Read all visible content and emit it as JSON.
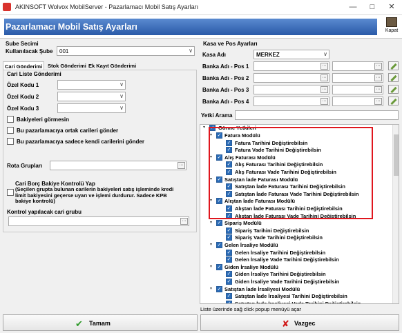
{
  "window": {
    "title": "AKINSOFT Wolvox MobilServer  - Pazarlamacı Mobil Satış Ayarları"
  },
  "header": {
    "title": "Pazarlamacı Mobil Satış Ayarları",
    "close_label": "Kapat"
  },
  "sube": {
    "section": "Sube Secimi",
    "label": "Kullanılacak Şube",
    "value": "001"
  },
  "tabs": [
    "Cari Gönderimi",
    "Stok Gönderimi",
    "Ek Kayıt Gönderimi"
  ],
  "cari": {
    "section": "Cari Liste Gönderimi",
    "ozel_kodlar": [
      "Özel Kodu 1",
      "Özel Kodu 2",
      "Özel Kodu 3"
    ],
    "options": [
      "Bakiyeleri görmesin",
      "Bu pazarlamacıya ortak carileri gönder",
      "Bu pazarlamacıya sadece kendi carilerini gönder"
    ],
    "rota_label": "Rota Grupları",
    "borc_title": "Cari Borç Bakiye Kontrolü Yap",
    "borc_desc": "(Seçilen grupta bulunan carilerin bakiyeleri satış işleminde kredi limit bakiyesini geçerse uyarı ve işlemi durdurur. Sadece KPB bakiye kontrolü)",
    "kontrol_label": "Kontrol yapılacak cari grubu"
  },
  "kasa": {
    "section": "Kasa ve Pos Ayarları",
    "kasa_label": "Kasa Adı",
    "kasa_value": "MERKEZ",
    "banks": [
      "Banka Adı - Pos 1",
      "Banka Adı - Pos 2",
      "Banka Adı - Pos 3",
      "Banka Adı - Pos 4"
    ],
    "yetki_label": "Yetki Arama"
  },
  "tree": {
    "root": "Görme Yetkileri",
    "hint": "Liste üzerinde sağ click popup menüyü açar",
    "modules": [
      {
        "name": "Fatura Modülü",
        "items": [
          "Fatura Tarihini Değiştirebilsin",
          "Fatura Vade Tarihini Değiştirebilsin"
        ]
      },
      {
        "name": "Alış Faturası Modülü",
        "items": [
          "Alış Faturası Tarihini Değiştirebilsin",
          "Alış Faturası Vade Tarihini Değiştirebilsin"
        ]
      },
      {
        "name": "Satıştan İade Faturası Modülü",
        "items": [
          "Satıştan İade Faturası Tarihini Değiştirebilsin",
          "Satıştan İade Faturası Vade Tarihini Değiştirebilsin"
        ]
      },
      {
        "name": "Alıştan İade Faturası Modülü",
        "items": [
          "Alıştan İade Faturası Tarihini Değiştirebilsin",
          "Alıştan İade Faturası Vade Tarihini Değiştirebilsin"
        ]
      },
      {
        "name": "Sipariş Modülü",
        "items": [
          "Sipariş Tarihini Değiştirebilsin",
          "Sipariş Vade Tarihini Değiştirebilsin"
        ]
      },
      {
        "name": "Gelen İrsaliye Modülü",
        "items": [
          "Gelen İrsaliye Tarihini Değiştirebilsin",
          "Gelen İrsaliye Vade Tarihini Değiştirebilsin"
        ]
      },
      {
        "name": "Giden İrsaliye Modülü",
        "items": [
          "Giden İrsaliye Tarihini Değiştirebilsin",
          "Giden İrsaliye Vade Tarihini Değiştirebilsin"
        ]
      },
      {
        "name": "Satıştan İade İrsaliyesi Modülü",
        "items": [
          "Satıştan İade İrsaliyesi Tarihini Değiştirebilsin",
          "Satıştan İade İrsaliyesi Vade Tarihini Değiştirebilsin"
        ]
      }
    ]
  },
  "buttons": {
    "ok": "Tamam",
    "cancel": "Vazgec"
  },
  "colors": {
    "header_start": "#5a8ad0",
    "header_end": "#2a5aa8",
    "highlight": "#e0161e",
    "check": "#2a6cb8"
  }
}
